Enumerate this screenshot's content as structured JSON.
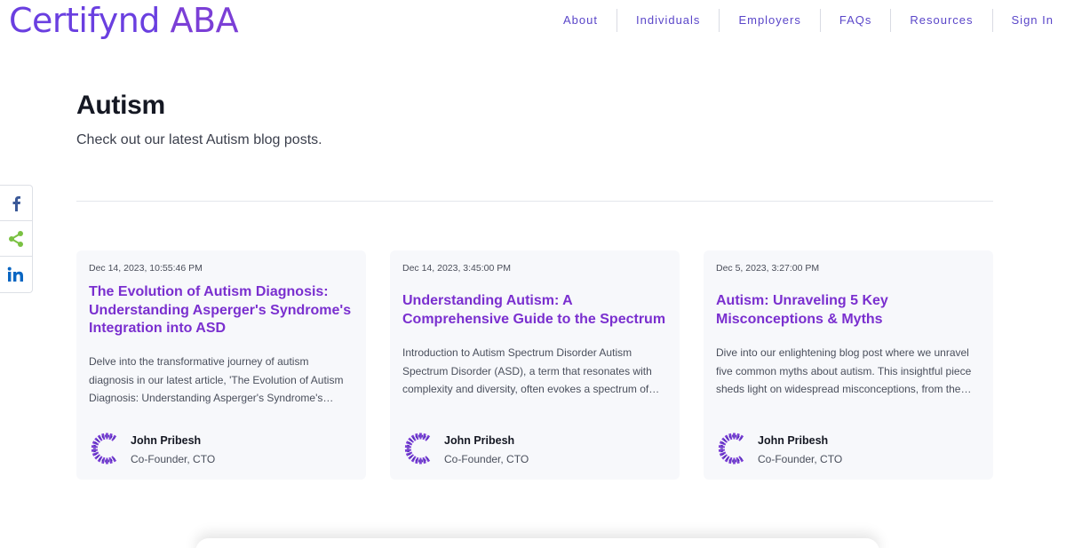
{
  "brand": {
    "name_part1": "Certifynd",
    "name_part2": "ABA"
  },
  "nav": {
    "items": [
      {
        "label": "About"
      },
      {
        "label": "Individuals"
      },
      {
        "label": "Employers"
      },
      {
        "label": "FAQs"
      },
      {
        "label": "Resources"
      },
      {
        "label": "Sign In"
      }
    ]
  },
  "page": {
    "title": "Autism",
    "subtitle": "Check out our latest Autism blog posts."
  },
  "share": {
    "icons": [
      "facebook-icon",
      "share-icon",
      "linkedin-icon"
    ],
    "colors": {
      "facebook": "#3b5998",
      "share": "#7ac142",
      "linkedin": "#0a66c2"
    }
  },
  "colors": {
    "brand": "#6a3fe0",
    "title_accent": "#7a2fcf",
    "nav": "#5a46c9"
  },
  "posts": [
    {
      "date": "Dec 14, 2023, 10:55:46 PM",
      "title": "The Evolution of Autism Diagnosis: Understanding Asperger's Syndrome's Integration into ASD",
      "excerpt": "Delve into the transformative journey of autism diagnosis in our latest article, 'The Evolution of Autism Diagnosis: Understanding Asperger's Syndrome's Integration into ASD.'",
      "author": "John Pribesh",
      "role": "Co-Founder, CTO"
    },
    {
      "date": "Dec 14, 2023, 3:45:00 PM",
      "title": "Understanding Autism: A Comprehensive Guide to the Spectrum",
      "excerpt": "Introduction to Autism Spectrum Disorder Autism Spectrum Disorder (ASD), a term that resonates with complexity and diversity, often evokes a spectrum of reactions and understanding.",
      "author": "John Pribesh",
      "role": "Co-Founder, CTO"
    },
    {
      "date": "Dec 5, 2023, 3:27:00 PM",
      "title": "Autism: Unraveling 5 Key Misconceptions & Myths",
      "excerpt": "Dive into our enlightening blog post where we unravel five common myths about autism. This insightful piece sheds light on widespread misconceptions, from the idea of a cure to beliefs about empathy.",
      "author": "John Pribesh",
      "role": "Co-Founder, CTO"
    }
  ]
}
